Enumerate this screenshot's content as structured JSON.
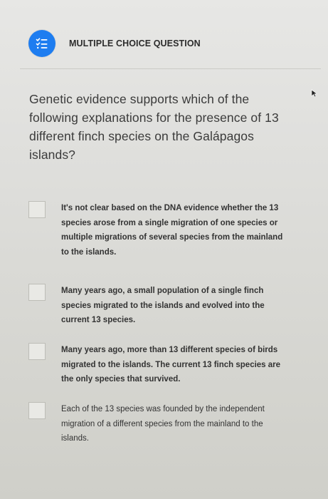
{
  "header": {
    "icon": "list-check-icon",
    "label": "MULTIPLE CHOICE QUESTION",
    "accent_color": "#1e7df0"
  },
  "question": {
    "text": "Genetic evidence supports which of the following explanations for the presence of 13 different finch species on the Galápagos islands?"
  },
  "options": [
    {
      "text": "It's not clear based on the DNA evidence whether the 13 species arose from a single migration of one species or multiple migrations of several species from the mainland to the islands.",
      "checked": false
    },
    {
      "text": "Many years ago, a small population of a single finch species migrated to the islands and evolved into the current 13 species.",
      "checked": false
    },
    {
      "text": "Many years ago, more than 13 different species of birds migrated to the islands. The current 13 finch species are the only species that survived.",
      "checked": false
    },
    {
      "text": "Each of the 13 species was founded by the independent migration of a different species from the mainland to the islands.",
      "checked": false
    }
  ]
}
